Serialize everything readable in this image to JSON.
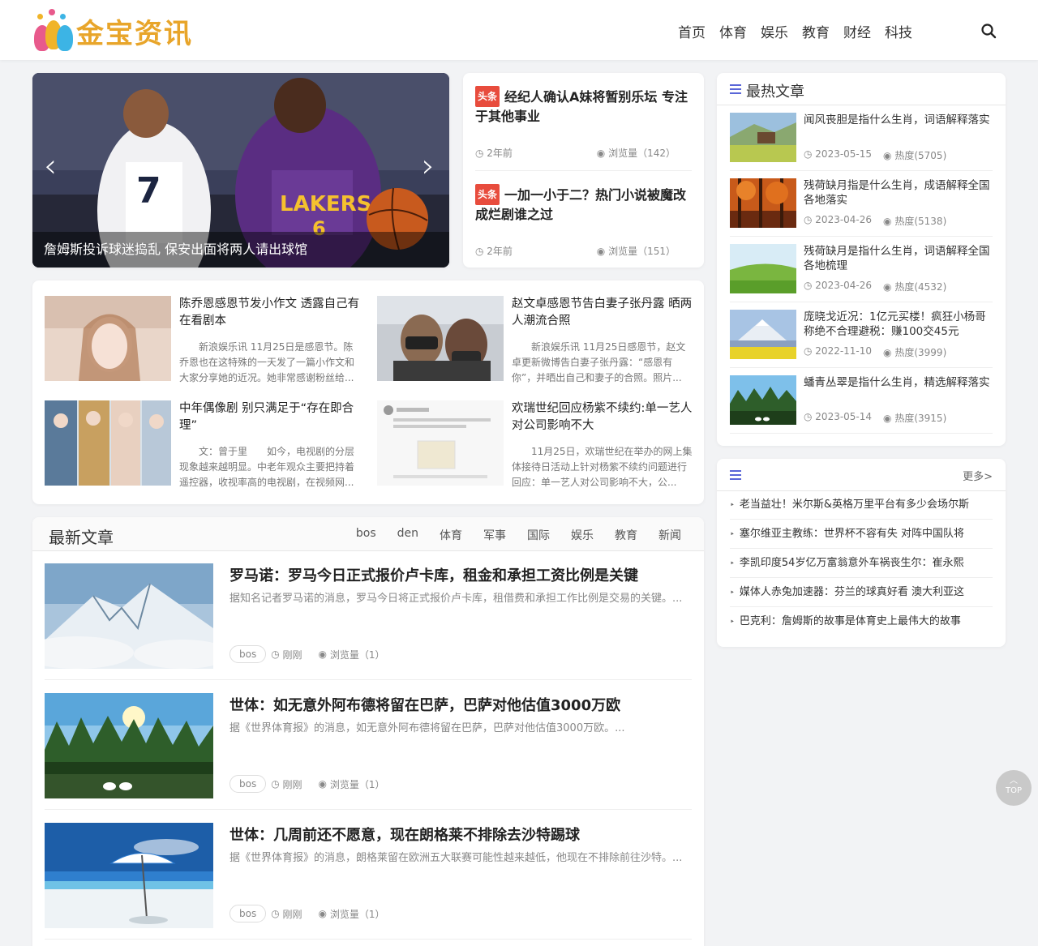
{
  "header": {
    "logo_text": "金宝资讯",
    "nav": [
      "首页",
      "体育",
      "娱乐",
      "教育",
      "财经",
      "科技"
    ]
  },
  "slider": {
    "caption": "詹姆斯投诉球迷捣乱 保安出面将两人请出球馆",
    "prev": "‹",
    "next": "›"
  },
  "headlines": [
    {
      "tag": "头条",
      "title": "经纪人确认A妹将暂别乐坛 专注于其他事业",
      "time": "2年前",
      "views": "浏览量（142）"
    },
    {
      "tag": "头条",
      "title": "一加一小于二？热门小说被魔改成烂剧谁之过",
      "time": "2年前",
      "views": "浏览量（151）"
    }
  ],
  "grid": [
    {
      "title": "陈乔恩感恩节发小作文 透露自己有在看剧本",
      "desc": "新浪娱乐讯 11月25日是感恩节。陈乔恩也在这特殊的一天发了一篇小作文和大家分享她的近况。她非常感谢粉丝给..."
    },
    {
      "title": "赵文卓感恩节告白妻子张丹露 晒两人潮流合照",
      "desc": "新浪娱乐讯 11月25日感恩节，赵文卓更新微博告白妻子张丹露：“感恩有你”，并晒出自己和妻子的合照。照片..."
    },
    {
      "title": "中年偶像剧 别只满足于“存在即合理”",
      "desc": "文：曾于里　　如今，电视剧的分层现象越来越明显。中老年观众主要把持着遥控器，收视率高的电视剧，在视频网..."
    },
    {
      "title": "欢瑞世纪回应杨紫不续约:单一艺人对公司影响不大",
      "desc": "11月25日，欢瑞世纪在举办的网上集体接待日活动上针对杨紫不续约问题进行回应：单一艺人对公司影响不大，公..."
    }
  ],
  "latest": {
    "title": "最新文章",
    "tabs": [
      "bos",
      "den",
      "体育",
      "军事",
      "国际",
      "娱乐",
      "教育",
      "新闻"
    ],
    "articles": [
      {
        "title": "罗马诺：罗马今日正式报价卢卡库，租金和承担工资比例是关键",
        "desc": "据知名记者罗马诺的消息，罗马今日将正式报价卢卡库，租借费和承担工作比例是交易的关键。...",
        "tag": "bos",
        "time": "刚刚",
        "views": "浏览量（1）"
      },
      {
        "title": "世体：如无意外阿布德将留在巴萨，巴萨对他估值3000万欧",
        "desc": "据《世界体育报》的消息，如无意外阿布德将留在巴萨，巴萨对他估值3000万欧。...",
        "tag": "bos",
        "time": "刚刚",
        "views": "浏览量（1）"
      },
      {
        "title": "世体：几周前还不愿意，现在朗格莱不排除去沙特踢球",
        "desc": "据《世界体育报》的消息，朗格莱留在欧洲五大联赛可能性越来越低，他现在不排除前往沙特。...",
        "tag": "bos",
        "time": "刚刚",
        "views": "浏览量（1）"
      }
    ]
  },
  "hot": {
    "title": "最热文章",
    "items": [
      {
        "title": "闻风丧胆是指什么生肖，词语解释落实",
        "date": "2023-05-15",
        "heat": "热度(5705)"
      },
      {
        "title": "残荷缺月指是什么生肖，成语解释全国各地落实",
        "date": "2023-04-26",
        "heat": "热度(5138)"
      },
      {
        "title": "残荷缺月是指什么生肖，词语解释全国各地梳理",
        "date": "2023-04-26",
        "heat": "热度(4532)"
      },
      {
        "title": "庞晓戈近况：1亿元买楼！疯狂小杨哥称绝不合理避税：赚100交45元",
        "date": "2022-11-10",
        "heat": "热度(3999)"
      },
      {
        "title": "蟠青丛翠是指什么生肖，精选解释落实",
        "date": "2023-05-14",
        "heat": "热度(3915)"
      }
    ]
  },
  "more": {
    "link": "更多>",
    "items": [
      "老当益壮！米尔斯&英格万里平台有多少会场尔斯",
      "塞尔维亚主教练：世界杯不容有失 对阵中国队将",
      "李凯印度54岁亿万富翁意外车祸丧生尔：崔永熙",
      "媒体人赤兔加速器：芬兰的球真好看 澳大利亚这",
      "巴克利：詹姆斯的故事是体育史上最伟大的故事"
    ]
  },
  "top_button": "TOP"
}
